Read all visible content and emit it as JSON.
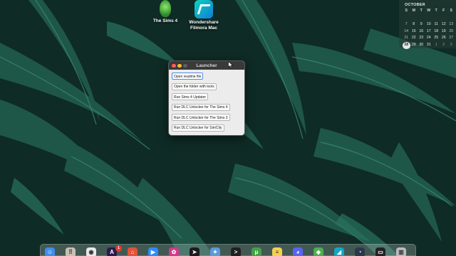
{
  "desktop": {
    "icons": [
      {
        "label": "The Sims 4"
      },
      {
        "label": "Wondershare\nFilmora Mac"
      }
    ]
  },
  "calendar": {
    "month": "OCTOBER",
    "weekdays": [
      "S",
      "M",
      "T",
      "W",
      "T",
      "F",
      "S"
    ],
    "rows": [
      [
        "",
        "",
        "",
        "",
        "",
        "",
        ""
      ],
      [
        "7",
        "8",
        "9",
        "10",
        "11",
        "12",
        "13"
      ],
      [
        "14",
        "15",
        "16",
        "17",
        "18",
        "19",
        "20"
      ],
      [
        "21",
        "22",
        "23",
        "24",
        "25",
        "26",
        "27"
      ],
      [
        "28",
        "29",
        "30",
        "31",
        "1",
        "2",
        "3"
      ]
    ],
    "today": "28"
  },
  "launcher": {
    "title": "Launcher",
    "buttons": [
      "Open readme file",
      "Open the folder with tools",
      "Run Sims 4 Updater",
      "Run DLC Unlocker for The Sims 4",
      "Run DLC Unlocker for The Sims 3",
      "Run DLC Unlocker for SimCity"
    ]
  },
  "dock": {
    "badge": "1",
    "apps": [
      {
        "icon": "finder-icon",
        "color": "#3e8ef0"
      },
      {
        "icon": "launchpad-icon",
        "color": "#c9c0b4"
      },
      {
        "icon": "chrome-icon",
        "color": "#e9e9e9"
      },
      {
        "icon": "adobe-icon",
        "color": "#2a1a4a"
      },
      {
        "icon": "home-icon",
        "color": "#e2533a"
      },
      {
        "icon": "zoom-icon",
        "color": "#2d8cff"
      },
      {
        "icon": "pink-app-icon",
        "color": "#d23a8a"
      },
      {
        "icon": "arrow-app-icon",
        "color": "#1b1b1b"
      },
      {
        "icon": "bird-app-icon",
        "color": "#5a9bd8"
      },
      {
        "icon": "terminal-icon",
        "color": "#1f1f1f"
      },
      {
        "icon": "torrent-icon",
        "color": "#43a047"
      },
      {
        "icon": "notes-icon",
        "color": "#f6d04d"
      },
      {
        "icon": "discord-icon",
        "color": "#5865f2"
      },
      {
        "icon": "sims-icon",
        "color": "#4caf50"
      },
      {
        "icon": "filmora-icon",
        "color": "#12a6c4"
      },
      {
        "icon": "dark-app-icon",
        "color": "#2a3a4a"
      },
      {
        "icon": "monitor-icon",
        "color": "#222222"
      },
      {
        "icon": "trash-icon",
        "color": "#bdbdbd"
      }
    ]
  }
}
